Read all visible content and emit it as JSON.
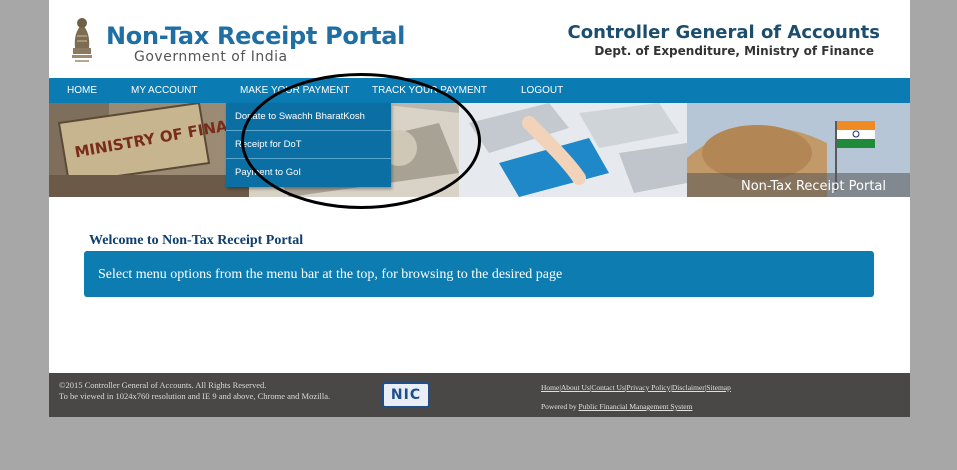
{
  "header": {
    "portal_title": "Non-Tax Receipt Portal",
    "portal_subtitle": "Government of India",
    "org_title": "Controller General of Accounts",
    "org_subtitle": "Dept. of Expenditure, Ministry of Finance",
    "emblem_icon": "national-emblem-icon"
  },
  "nav": {
    "items": [
      {
        "label": "HOME"
      },
      {
        "label": "MY ACCOUNT"
      },
      {
        "label": "MAKE YOUR PAYMENT"
      },
      {
        "label": "TRACK YOUR PAYMENT"
      },
      {
        "label": "LOGOUT"
      }
    ]
  },
  "dropdown": {
    "items": [
      {
        "label": "Donate to Swachh BharatKosh"
      },
      {
        "label": "Receipt for DoT"
      },
      {
        "label": "Payment to GoI"
      }
    ]
  },
  "banner": {
    "caption": "Non-Tax Receipt Portal",
    "sign_text": "MINISTRY OF FINANCE"
  },
  "welcome": {
    "title": "Welcome to Non-Tax Receipt Portal",
    "message": "Select menu options from the menu bar at the top, for browsing to the desired page"
  },
  "footer": {
    "copyright_line1": "©2015 Controller General of Accounts. All Rights Reserved.",
    "copyright_line2": "To be viewed in 1024x760 resolution and IE 9 and above, Chrome and Mozilla.",
    "nic_label": "NIC",
    "links": [
      "Home",
      "About Us",
      "Contact Us",
      "Privacy Policy",
      "Disclaimer",
      "Sitemap"
    ],
    "powered_prefix": "Powered by",
    "powered_link": "Public Financial Management System"
  },
  "colors": {
    "nav_bg": "#0b7bb3",
    "dropdown_bg": "#0c6fa3",
    "welcome_box": "#0d7cb0",
    "footer_bg": "#4a4747",
    "title_blue": "#1f6fa3"
  }
}
